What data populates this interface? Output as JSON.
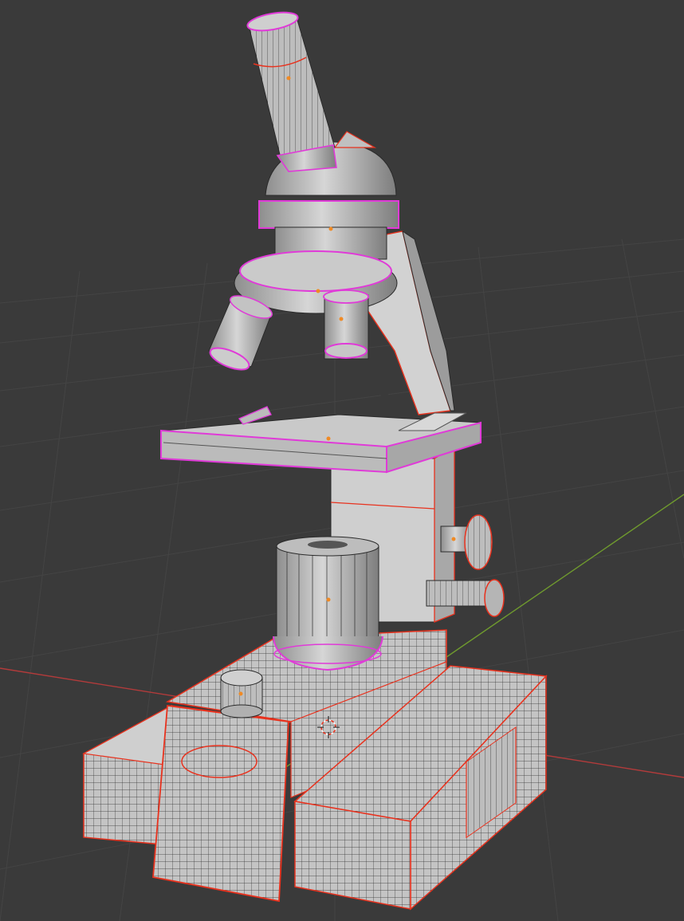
{
  "viewport": {
    "background": "#3a3a3a",
    "grid_color": "#444444",
    "x_axis_color": "#b23b3b",
    "y_axis_color": "#6f9a2e",
    "mesh_face": "#c8c8c8",
    "mesh_face_dark": "#9a9a9a",
    "wire_color": "#2a2a2a",
    "select_outline": "#e8321e",
    "active_outline": "#e03ad8",
    "origin_dot": "#f08a24",
    "cursor_icon": "3d-cursor-icon"
  }
}
